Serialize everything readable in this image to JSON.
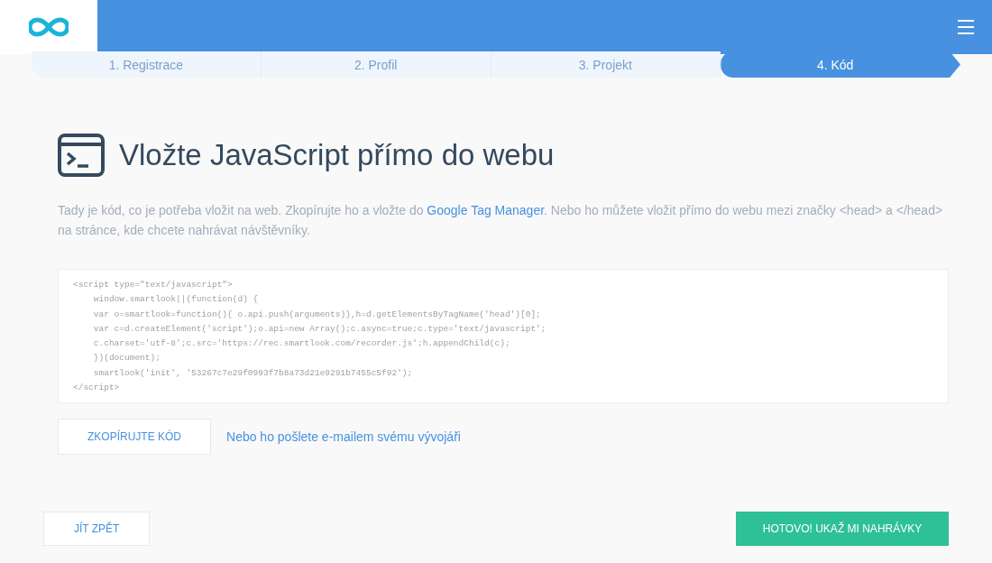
{
  "steps": [
    {
      "label": "1. Registrace",
      "selected": false
    },
    {
      "label": "2. Profil",
      "selected": false
    },
    {
      "label": "3. Projekt",
      "selected": false
    },
    {
      "label": "4. Kód",
      "selected": true
    }
  ],
  "heading": "Vložte JavaScript přímo do webu",
  "description": {
    "before": "Tady je kód, co je potřeba vložit na web. Zkopírujte ho a vložte do",
    "link": "Google Tag Manager",
    "after": ". Nebo ho můžete vložit přímo do webu mezi značky <head> a </head> na stránce, kde chcete nahrávat návštěvníky."
  },
  "code": "<script type=\"text/javascript\">\n    window.smartlook||(function(d) {\n    var o=smartlook=function(){ o.api.push(arguments)},h=d.getElementsByTagName('head')[0];\n    var c=d.createElement('script');o.api=new Array();c.async=true;c.type='text/javascript';\n    c.charset='utf-8';c.src='https://rec.smartlook.com/recorder.js';h.appendChild(c);\n    })(document);\n    smartlook('init', '53267c7e29f0993f7b8a73d21e9291b7455c5f92');\n</script>",
  "copy_button": "ZKOPÍRUJTE KÓD",
  "email_link": "Nebo ho pošlete e-mailem svému vývojáři",
  "back_button": "JÍT ZPĚT",
  "done_button": "HOTOVO! UKAŽ MI NAHRÁVKY"
}
